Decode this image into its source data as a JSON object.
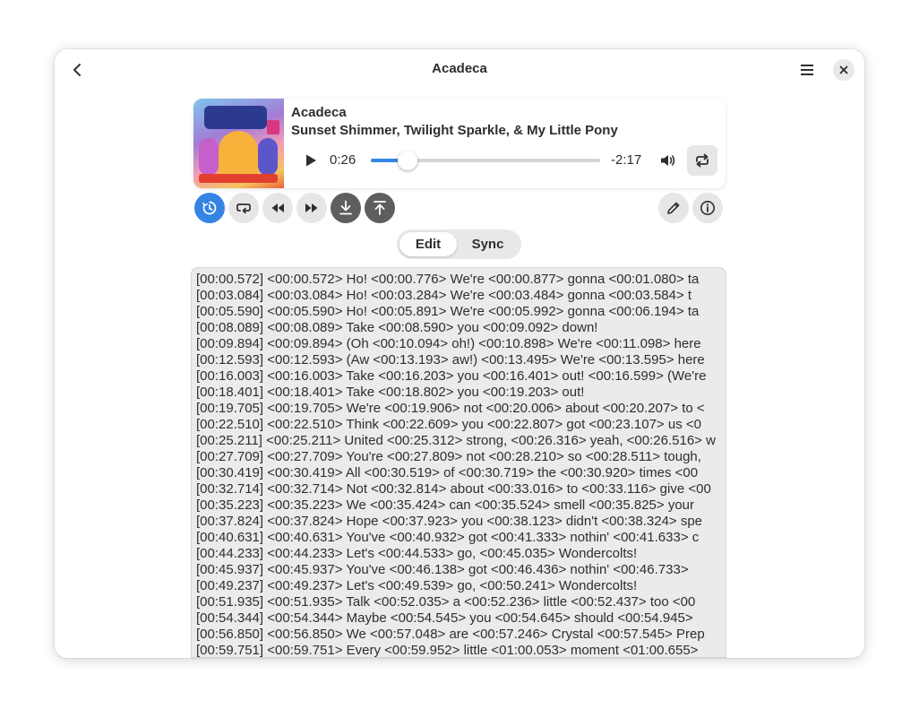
{
  "window": {
    "title": "Acadeca"
  },
  "player": {
    "title": "Acadeca",
    "artist": "Sunset Shimmer, Twilight Sparkle, & My Little Pony",
    "time_current": "0:26",
    "time_remaining": "-2:17",
    "progress": 0.16
  },
  "modes": {
    "edit_label": "Edit",
    "sync_label": "Sync",
    "active": "Edit"
  },
  "colors": {
    "accent": "#3584e4"
  },
  "icons": {
    "back": "go-back-icon",
    "menu": "hamburger-menu-icon",
    "close": "close-icon",
    "play": "play-icon",
    "volume": "volume-icon",
    "repeat": "repeat-icon",
    "timer": "timer-icon",
    "loop": "loop-icon",
    "rewind": "rewind-icon",
    "forward": "fast-forward-icon",
    "download": "download-icon",
    "upload": "upload-icon",
    "edit": "pencil-icon",
    "info": "info-icon"
  },
  "lyrics": [
    "[00:00.572] <00:00.572> Ho! <00:00.776> We're <00:00.877> gonna <00:01.080> ta",
    "[00:03.084] <00:03.084> Ho! <00:03.284> We're <00:03.484> gonna <00:03.584> t",
    "[00:05.590] <00:05.590> Ho! <00:05.891> We're <00:05.992> gonna <00:06.194> ta",
    "[00:08.089] <00:08.089> Take <00:08.590> you <00:09.092> down!",
    "[00:09.894] <00:09.894> (Oh <00:10.094> oh!) <00:10.898> We're <00:11.098> here",
    "[00:12.593] <00:12.593> (Aw <00:13.193> aw!) <00:13.495> We're <00:13.595> here",
    "[00:16.003] <00:16.003> Take <00:16.203> you <00:16.401> out! <00:16.599> (We're",
    "[00:18.401] <00:18.401> Take <00:18.802> you <00:19.203> out!",
    "[00:19.705] <00:19.705> We're <00:19.906> not <00:20.006> about <00:20.207> to <",
    "[00:22.510] <00:22.510> Think <00:22.609> you <00:22.807> got <00:23.107> us <0",
    "[00:25.211] <00:25.211> United <00:25.312> strong, <00:26.316> yeah, <00:26.516> w",
    "[00:27.709] <00:27.709> You're <00:27.809> not <00:28.210> so <00:28.511> tough,",
    "[00:30.419] <00:30.419> All <00:30.519> of <00:30.719> the <00:30.920> times <00",
    "[00:32.714] <00:32.714> Not <00:32.814> about <00:33.016> to <00:33.116> give <00",
    "[00:35.223] <00:35.223> We <00:35.424> can <00:35.524> smell <00:35.825> your",
    "[00:37.824] <00:37.824> Hope <00:37.923> you <00:38.123> didn't <00:38.324> spe",
    "[00:40.631] <00:40.631> You've <00:40.932> got <00:41.333> nothin' <00:41.633> c",
    "[00:44.233] <00:44.233> Let's <00:44.533> go, <00:45.035> Wondercolts!",
    "[00:45.937] <00:45.937> You've <00:46.138> got <00:46.436> nothin' <00:46.733>",
    "[00:49.237] <00:49.237> Let's <00:49.539> go, <00:50.241> Wondercolts!",
    "[00:51.935] <00:51.935> Talk <00:52.035> a <00:52.236> little <00:52.437> too <00",
    "[00:54.344] <00:54.344> Maybe <00:54.545> you <00:54.645> should <00:54.945>",
    "[00:56.850] <00:56.850> We <00:57.048> are <00:57.246> Crystal <00:57.545> Prep",
    "[00:59.751] <00:59.751> Every <00:59.952> little <01:00.053> moment <01:00.655>"
  ]
}
